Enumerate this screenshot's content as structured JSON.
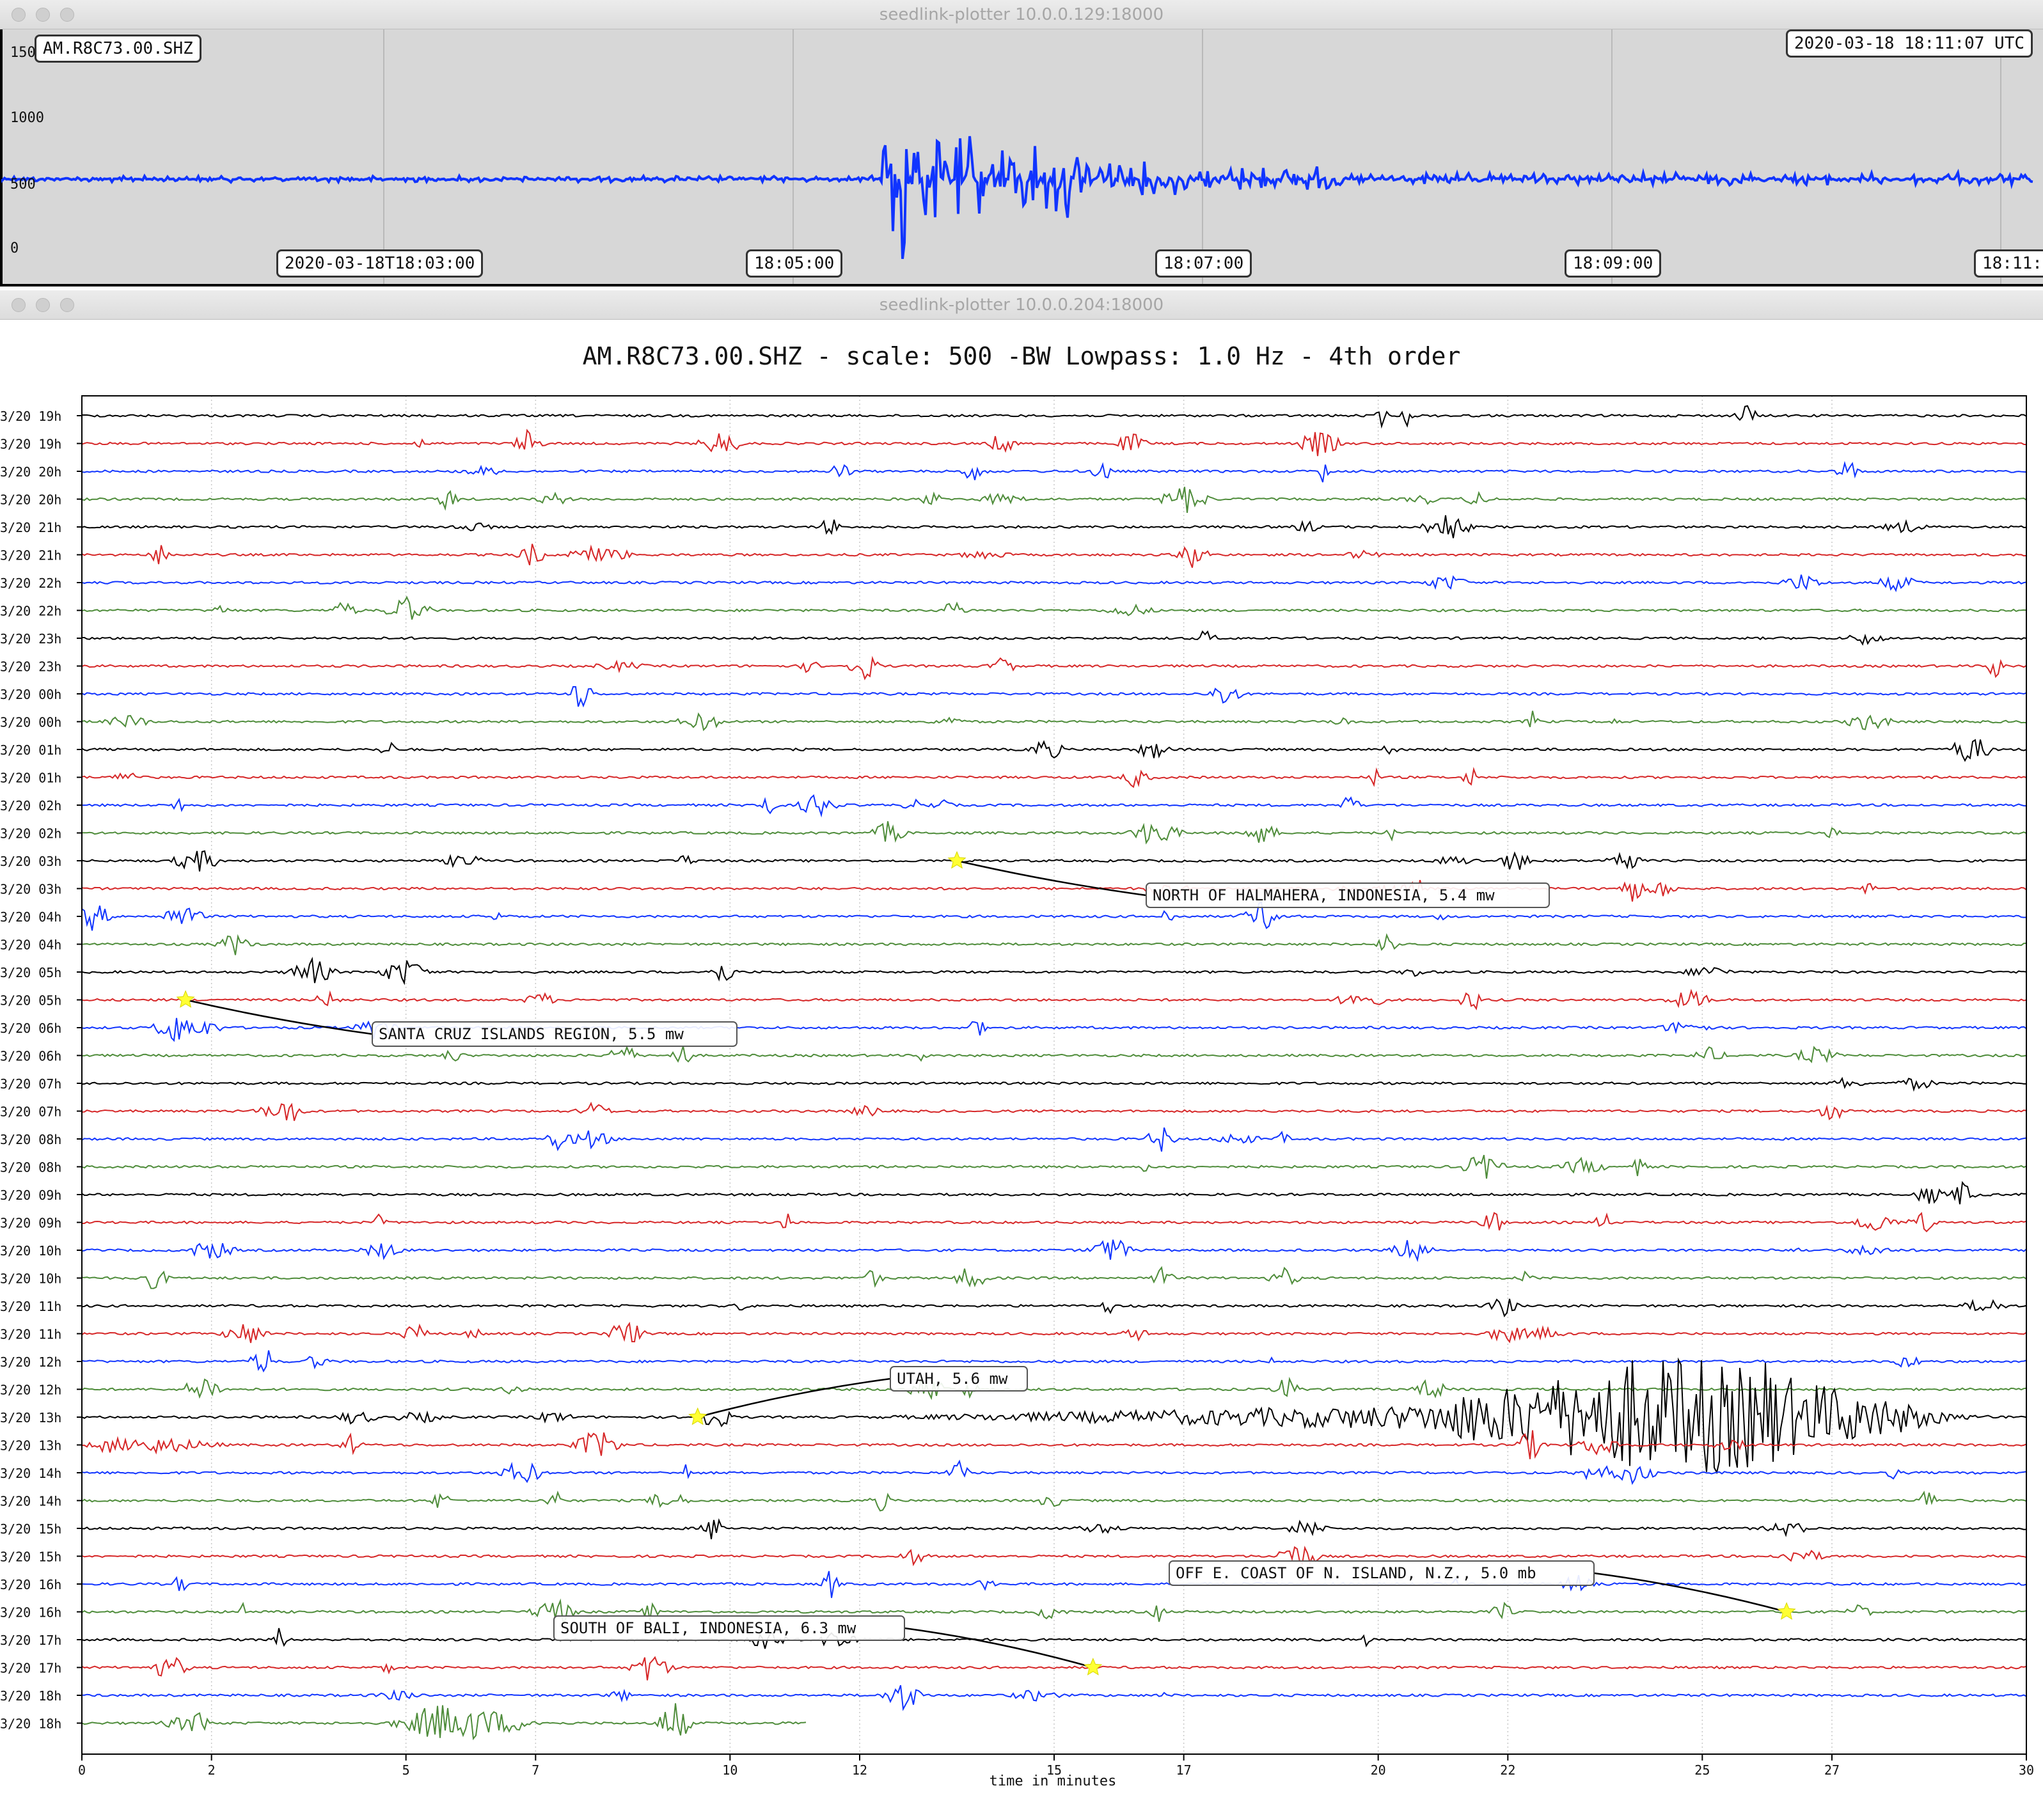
{
  "top_window": {
    "title": "seedlink-plotter 10.0.0.129:18000",
    "station_label": "AM.R8C73.00.SHZ",
    "timestamp": "2020-03-18 18:11:07 UTC",
    "y_ticks": [
      "1500",
      "1000",
      "500",
      "0"
    ],
    "time_ticks": [
      "2020-03-18T18:03:00",
      "18:05:00",
      "18:07:00",
      "18:09:00",
      "18:11:"
    ],
    "trace_color": "#1034ff"
  },
  "bottom_window": {
    "title": "seedlink-plotter 10.0.0.204:18000",
    "plot_title": "AM.R8C73.00.SHZ - scale: 500 -BW Lowpass: 1.0 Hz - 4th order"
  },
  "chart_data": {
    "type": "line",
    "title": "AM.R8C73.00.SHZ - scale: 500 -BW Lowpass: 1.0 Hz - 4th order",
    "xlabel": "time in minutes",
    "xlim": [
      0,
      30
    ],
    "x_ticks": [
      0,
      2,
      5,
      7,
      10,
      12,
      15,
      17,
      20,
      22,
      25,
      27,
      30
    ],
    "row_labels": [
      "3/20 19h",
      "3/20 19h",
      "3/20 20h",
      "3/20 20h",
      "3/20 21h",
      "3/20 21h",
      "3/20 22h",
      "3/20 22h",
      "3/20 23h",
      "3/20 23h",
      "3/20 00h",
      "3/20 00h",
      "3/20 01h",
      "3/20 01h",
      "3/20 02h",
      "3/20 02h",
      "3/20 03h",
      "3/20 03h",
      "3/20 04h",
      "3/20 04h",
      "3/20 05h",
      "3/20 05h",
      "3/20 06h",
      "3/20 06h",
      "3/20 07h",
      "3/20 07h",
      "3/20 08h",
      "3/20 08h",
      "3/20 09h",
      "3/20 09h",
      "3/20 10h",
      "3/20 10h",
      "3/20 11h",
      "3/20 11h",
      "3/20 12h",
      "3/20 12h",
      "3/20 13h",
      "3/20 13h",
      "3/20 14h",
      "3/20 14h",
      "3/20 15h",
      "3/20 15h",
      "3/20 16h",
      "3/20 16h",
      "3/20 17h",
      "3/20 17h",
      "3/20 18h",
      "3/20 18h"
    ],
    "colors": [
      "#000000",
      "#d62728",
      "#1034ff",
      "#4e8c3a"
    ],
    "last_trace_end_minute": 11.2,
    "events": [
      {
        "label": "NORTH OF HALMAHERA, INDONESIA, 5.4 mw",
        "row": 16,
        "minute": 13.5,
        "star_color": "#ffff33"
      },
      {
        "label": "SANTA CRUZ ISLANDS REGION, 5.5 mw",
        "row": 21,
        "minute": 1.6,
        "star_color": "#ffff33"
      },
      {
        "label": "UTAH, 5.6 mw",
        "row": 36,
        "minute": 9.5,
        "star_color": "#ffff33"
      },
      {
        "label": "OFF E. COAST OF N. ISLAND, N.Z., 5.0 mb",
        "row": 43,
        "minute": 26.3,
        "star_color": "#ffff33"
      },
      {
        "label": "SOUTH OF BALI, INDONESIA, 6.3 mw",
        "row": 45,
        "minute": 15.6,
        "star_color": "#ffff33"
      }
    ]
  }
}
